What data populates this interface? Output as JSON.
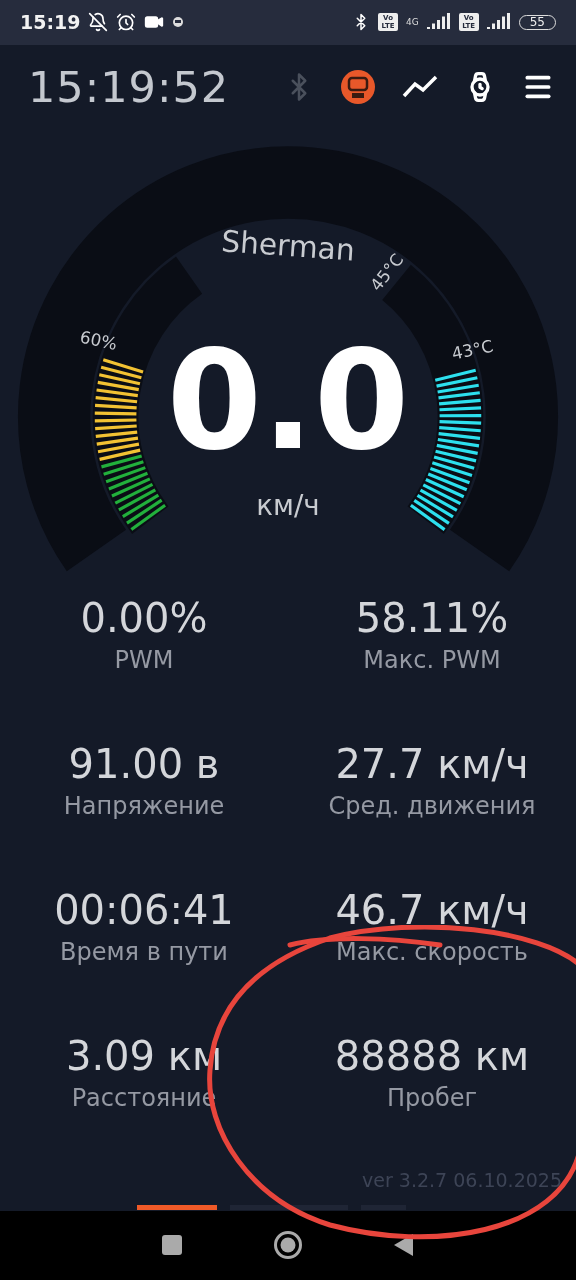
{
  "status_bar": {
    "time": "15:19",
    "battery": "55",
    "network": "4G",
    "volte": [
      "Vo LTE",
      "Vo LTE"
    ]
  },
  "header": {
    "clock": "15:19:52"
  },
  "gauge": {
    "model": "Sherman",
    "speed": "0.0",
    "unit": "км/ч",
    "battery": {
      "label": "60%",
      "level": 0.6
    },
    "temperature": {
      "label": "43°C",
      "max_label": "45°C"
    }
  },
  "stats": [
    {
      "value": "0.00%",
      "label": "PWM"
    },
    {
      "value": "58.11%",
      "label": "Макс. PWM"
    },
    {
      "value": "91.00 в",
      "label": "Напряжение"
    },
    {
      "value": "27.7 км/ч",
      "label": "Сред. движения"
    },
    {
      "value": "00:06:41",
      "label": "Время в пути"
    },
    {
      "value": "46.7 км/ч",
      "label": "Макс. скорость"
    },
    {
      "value": "3.09 км",
      "label": "Расстояние"
    },
    {
      "value": "88888 км",
      "label": "Пробег"
    }
  ],
  "version": "ver 3.2.7 06.10.2025",
  "pages": [
    {
      "selected": true
    },
    {
      "selected": false
    },
    {
      "selected": false
    }
  ]
}
